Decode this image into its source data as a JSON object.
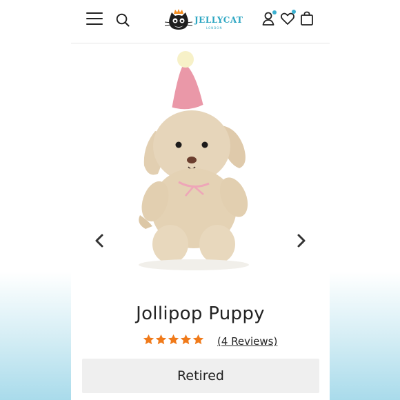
{
  "header": {
    "logo_text": "JELLYCAT",
    "logo_sub": "LONDON",
    "icons": [
      "menu-icon",
      "search-icon",
      "account-icon",
      "wishlist-icon",
      "bag-icon"
    ],
    "accent_color": "#3bb0d0"
  },
  "product": {
    "name": "Jollipop Puppy",
    "rating": 5,
    "reviews_label": "(4 Reviews)",
    "status_label": "Retired",
    "star_color": "#f07a1a"
  },
  "carousel": {
    "prev_icon": "chevron-left-icon",
    "next_icon": "chevron-right-icon"
  }
}
